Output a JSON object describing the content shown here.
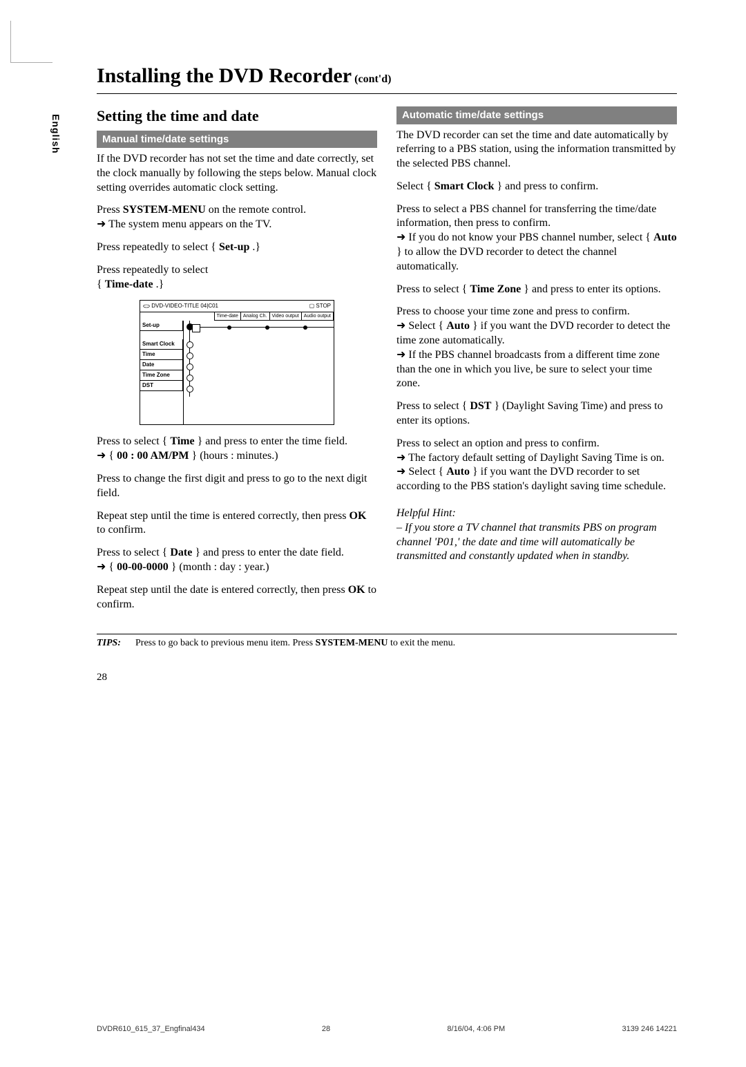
{
  "lang_tab": "English",
  "title_main": "Installing the DVD Recorder",
  "title_sub": "(cont'd)",
  "left": {
    "heading": "Setting the time and date",
    "bar": "Manual time/date settings",
    "p1": "If the DVD recorder has not set the time and date correctly, set the clock manually by following the steps below. Manual clock setting overrides automatic clock setting.",
    "p2a": "Press ",
    "p2b": "SYSTEM-MENU",
    "p2c": " on the remote control.",
    "p2_arrow": "The system menu appears on the TV.",
    "p3a": "Press    repeatedly to select { ",
    "p3b": "Set-up",
    "p3c": " .}",
    "p4a": "Press    repeatedly to select",
    "p4b": "{ ",
    "p4c": "Time-date",
    "p4d": " .}",
    "p5a": "Press    to select { ",
    "p5b": "Time",
    "p5c": " } and press    to enter the time field.",
    "p5_arrow_a": "{ ",
    "p5_arrow_b": "00 : 00 AM/PM",
    "p5_arrow_c": " } (hours : minutes.)",
    "p6": "Press       to change the first digit and press    to go to the next digit field.",
    "p7a": "Repeat step     until the time is entered correctly, then press ",
    "p7b": "OK",
    "p7c": " to confirm.",
    "p8a": "Press    to select { ",
    "p8b": "Date",
    "p8c": " } and press    to enter the date field.",
    "p8_arrow_a": "{ ",
    "p8_arrow_b": "00-00-0000",
    "p8_arrow_c": " } (month : day : year.)",
    "p9a": "Repeat step     until the date is entered correctly, then press ",
    "p9b": "OK",
    "p9c": " to confirm."
  },
  "osd": {
    "header_left": "DVD-VIDEO-TITLE 04|C01",
    "header_right": "STOP",
    "tabs": [
      "Time-date",
      "Analog Ch.",
      "Video output",
      "Audio output"
    ],
    "side": [
      "Set-up",
      "Smart Clock",
      "Time",
      "Date",
      "Time Zone",
      "DST"
    ]
  },
  "right": {
    "bar": "Automatic time/date settings",
    "p1": "The DVD recorder can set the time and date automatically by referring to a PBS station, using the information transmitted by the selected PBS channel.",
    "p2a": "Select { ",
    "p2b": "Smart Clock",
    "p2c": " } and press    to confirm.",
    "p3a": "Press       to select a PBS channel for transferring the time/date information, then press    to confirm.",
    "p3_arrow_a": "If you do not know your PBS channel number, select { ",
    "p3_arrow_b": "Auto",
    "p3_arrow_c": " } to allow the DVD recorder to detect the channel automatically.",
    "p4a": "Press    to select { ",
    "p4b": "Time Zone",
    "p4c": " } and press    to enter its options.",
    "p5a": "Press       to choose your time zone and press    to confirm.",
    "p5_arrow_a": "Select { ",
    "p5_arrow_b": "Auto",
    "p5_arrow_c": " } if you want the DVD recorder to detect the time zone automatically.",
    "p5_arrow2": "If the PBS channel broadcasts from a different time zone than the one in which you live, be sure to select your time zone.",
    "p6a": "Press    to select { ",
    "p6b": "DST",
    "p6c": " } (Daylight Saving Time) and press    to enter its options.",
    "p7": "Press       to select an option and press    to confirm.",
    "p7_arrow1": "The factory default setting of Daylight Saving Time is on.",
    "p7_arrow2a": "Select { ",
    "p7_arrow2b": "Auto",
    "p7_arrow2c": " } if you want the DVD recorder to set according to the PBS station's daylight saving time schedule.",
    "hint_title": "Helpful Hint:",
    "hint_body": "– If you store a TV channel that transmits PBS on program channel 'P01,' the date and time will automatically be transmitted and constantly updated when in standby."
  },
  "tips": {
    "label": "TIPS:",
    "text_a": "Press    to go back to previous menu item.  Press ",
    "text_b": "SYSTEM-MENU",
    "text_c": " to exit the menu."
  },
  "page_number": "28",
  "footer": {
    "left": "DVDR610_615_37_Engfinal434",
    "mid": "28",
    "date": "8/16/04, 4:06 PM",
    "code": "3139 246 14221"
  }
}
